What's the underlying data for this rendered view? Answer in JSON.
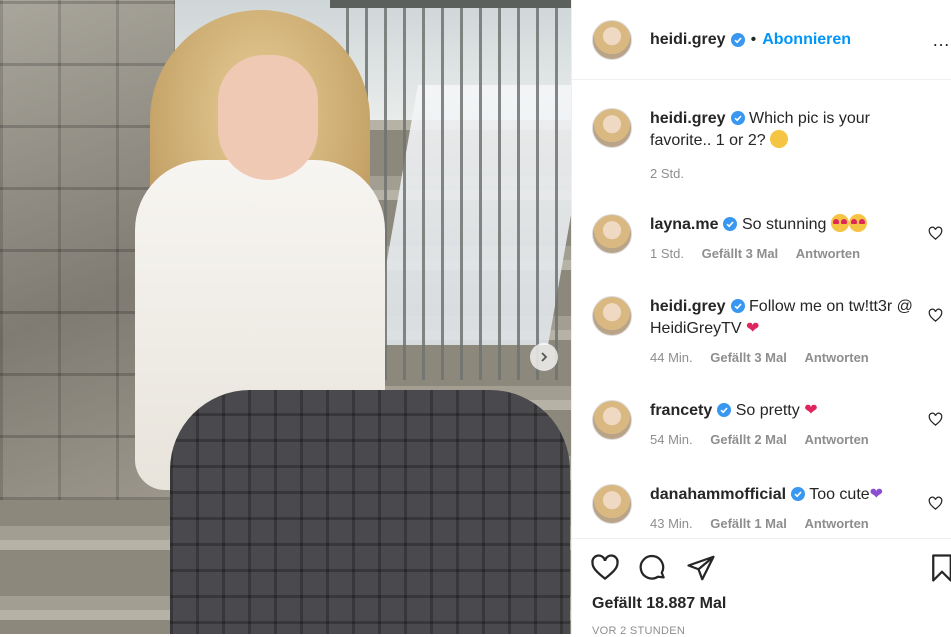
{
  "post": {
    "username": "heidi.grey",
    "separator": "•",
    "follow_label": "Abonnieren",
    "more_label": "…"
  },
  "caption": {
    "username": "heidi.grey",
    "text": "Which pic is your favorite.. 1 or 2?",
    "emoji": "thinking-face",
    "time": "2 Std."
  },
  "comments": [
    {
      "username": "layna.me",
      "text": "So stunning",
      "emoji": "heart-eyes x2",
      "time": "1 Std.",
      "likes": "Gefällt 3 Mal",
      "reply": "Antworten"
    },
    {
      "username": "heidi.grey",
      "text": "Follow me on tw!tt3r @ HeidiGreyTV",
      "emoji": "red-heart",
      "time": "44 Min.",
      "likes": "Gefällt 3 Mal",
      "reply": "Antworten"
    },
    {
      "username": "francety",
      "text": "So pretty",
      "emoji": "red-heart",
      "time": "54 Min.",
      "likes": "Gefällt 2 Mal",
      "reply": "Antworten"
    },
    {
      "username": "danahammofficial",
      "text": "Too cute",
      "emoji": "purple-heart",
      "time": "43 Min.",
      "likes": "Gefällt 1 Mal",
      "reply": "Antworten"
    }
  ],
  "footer": {
    "likes": "Gefällt 18.887 Mal",
    "posted": "VOR 2 STUNDEN"
  },
  "colors": {
    "link_blue": "#0095f6",
    "text": "#262626",
    "muted": "#8e8e8e",
    "verified": "#3897f0"
  }
}
